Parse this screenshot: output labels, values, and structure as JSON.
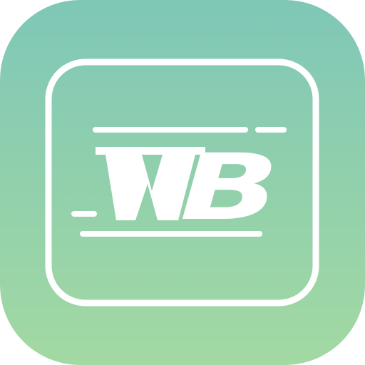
{
  "icon": {
    "name": "WB app icon",
    "logo_text": "WB",
    "colors": {
      "gradient_top": "#7fc7b7",
      "gradient_bottom": "#a3d9a2",
      "foreground": "#ffffff"
    }
  }
}
